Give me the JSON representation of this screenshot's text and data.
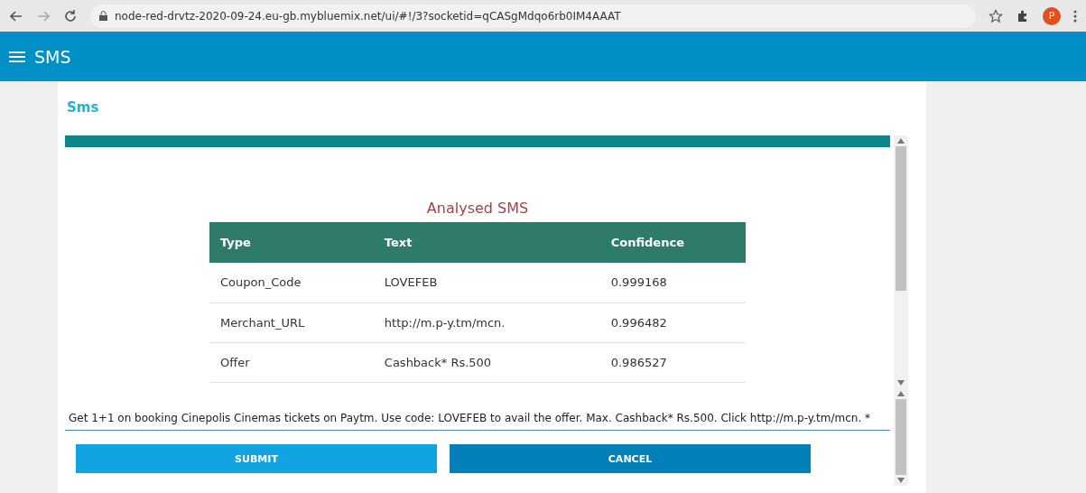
{
  "browser": {
    "url": "node-red-drvtz-2020-09-24.eu-gb.mybluemix.net/ui/#!/3?socketid=qCASgMdqo6rb0IM4AAAT",
    "profile_initial": "P"
  },
  "header": {
    "title": "SMS"
  },
  "card": {
    "title": "Sms"
  },
  "table": {
    "title": "Analysed SMS",
    "columns": [
      "Type",
      "Text",
      "Confidence"
    ],
    "rows": [
      [
        "Coupon_Code",
        "LOVEFEB",
        "0.999168"
      ],
      [
        "Merchant_URL",
        "http://m.p-y.tm/mcn.",
        "0.996482"
      ],
      [
        "Offer",
        "Cashback* Rs.500",
        "0.986527"
      ]
    ]
  },
  "input": {
    "value": "Get 1+1 on booking Cinepolis Cinemas tickets on Paytm. Use code: LOVEFEB to avail the offer. Max. Cashback* Rs.500. Click http://m.p-y.tm/mcn. *"
  },
  "buttons": [
    {
      "label": "SUBMIT",
      "kind": "light"
    },
    {
      "label": "CANCEL",
      "kind": "dark"
    }
  ]
}
